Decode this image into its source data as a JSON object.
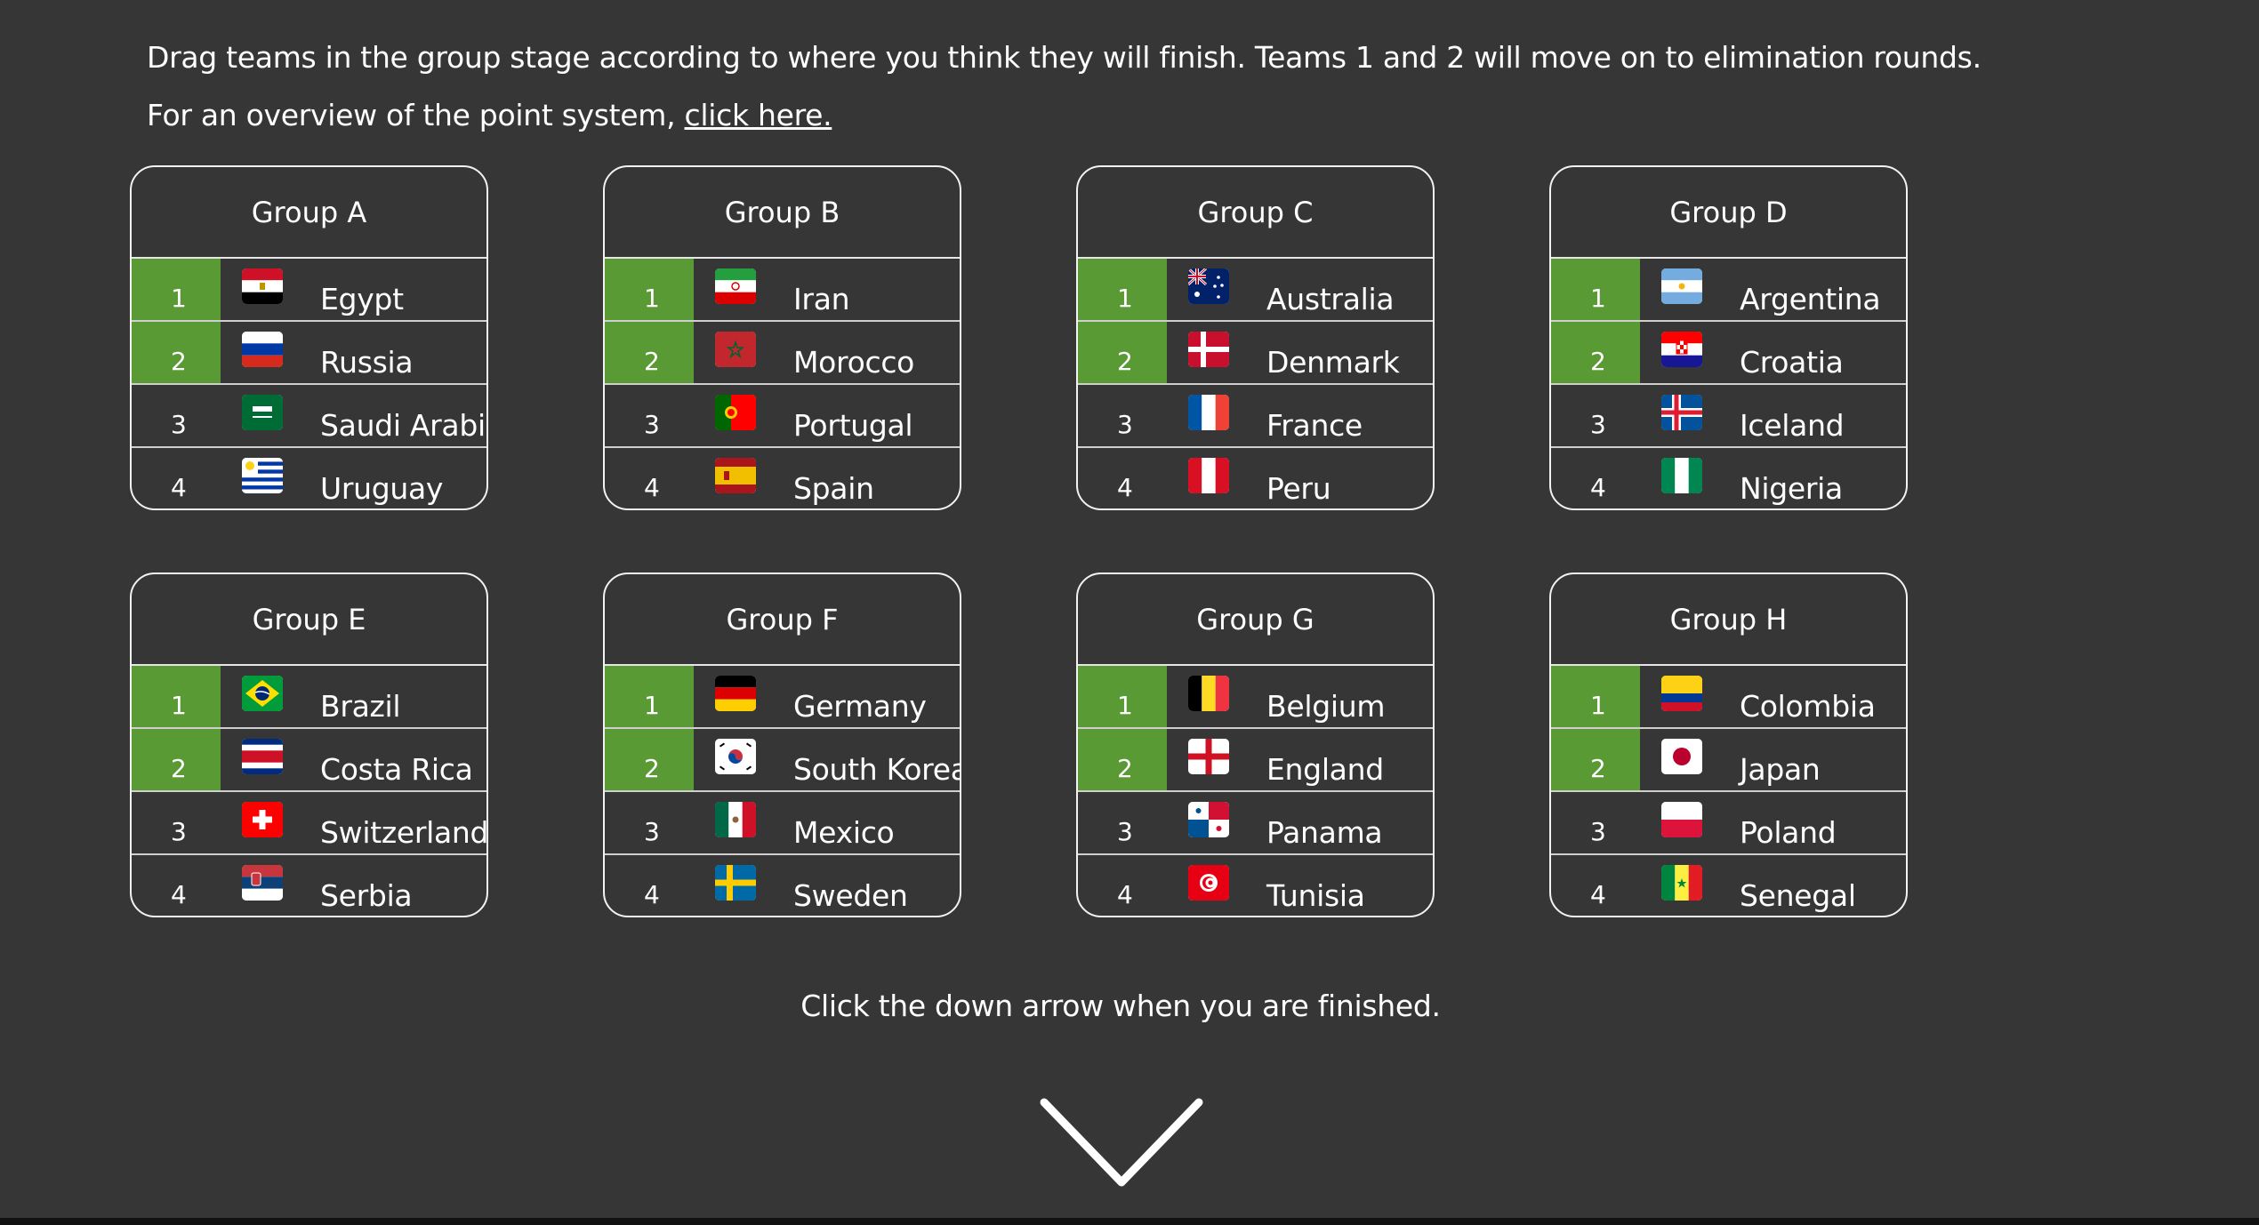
{
  "intro": {
    "line1": "Drag teams in the group stage according to where you think they will finish. Teams 1 and 2 will move on to elimination rounds.",
    "line2_prefix": "For an overview of the point system, ",
    "line2_link": "click here."
  },
  "colors": {
    "background": "#363636",
    "advance_green": "#5a9a35",
    "text": "#ffffff"
  },
  "groups": [
    {
      "title": "Group A",
      "teams": [
        {
          "rank": "1",
          "name": "Egypt",
          "flag": "egypt-flag-icon"
        },
        {
          "rank": "2",
          "name": "Russia",
          "flag": "russia-flag-icon"
        },
        {
          "rank": "3",
          "name": "Saudi Arabia",
          "flag": "saudi-arabia-flag-icon"
        },
        {
          "rank": "4",
          "name": "Uruguay",
          "flag": "uruguay-flag-icon"
        }
      ]
    },
    {
      "title": "Group B",
      "teams": [
        {
          "rank": "1",
          "name": "Iran",
          "flag": "iran-flag-icon"
        },
        {
          "rank": "2",
          "name": "Morocco",
          "flag": "morocco-flag-icon"
        },
        {
          "rank": "3",
          "name": "Portugal",
          "flag": "portugal-flag-icon"
        },
        {
          "rank": "4",
          "name": "Spain",
          "flag": "spain-flag-icon"
        }
      ]
    },
    {
      "title": "Group C",
      "teams": [
        {
          "rank": "1",
          "name": "Australia",
          "flag": "australia-flag-icon"
        },
        {
          "rank": "2",
          "name": "Denmark",
          "flag": "denmark-flag-icon"
        },
        {
          "rank": "3",
          "name": "France",
          "flag": "france-flag-icon"
        },
        {
          "rank": "4",
          "name": "Peru",
          "flag": "peru-flag-icon"
        }
      ]
    },
    {
      "title": "Group D",
      "teams": [
        {
          "rank": "1",
          "name": "Argentina",
          "flag": "argentina-flag-icon"
        },
        {
          "rank": "2",
          "name": "Croatia",
          "flag": "croatia-flag-icon"
        },
        {
          "rank": "3",
          "name": "Iceland",
          "flag": "iceland-flag-icon"
        },
        {
          "rank": "4",
          "name": "Nigeria",
          "flag": "nigeria-flag-icon"
        }
      ]
    },
    {
      "title": "Group E",
      "teams": [
        {
          "rank": "1",
          "name": "Brazil",
          "flag": "brazil-flag-icon"
        },
        {
          "rank": "2",
          "name": "Costa Rica",
          "flag": "costa-rica-flag-icon"
        },
        {
          "rank": "3",
          "name": "Switzerland",
          "flag": "switzerland-flag-icon"
        },
        {
          "rank": "4",
          "name": "Serbia",
          "flag": "serbia-flag-icon"
        }
      ]
    },
    {
      "title": "Group F",
      "teams": [
        {
          "rank": "1",
          "name": "Germany",
          "flag": "germany-flag-icon"
        },
        {
          "rank": "2",
          "name": "South Korea",
          "flag": "south-korea-flag-icon"
        },
        {
          "rank": "3",
          "name": "Mexico",
          "flag": "mexico-flag-icon"
        },
        {
          "rank": "4",
          "name": "Sweden",
          "flag": "sweden-flag-icon"
        }
      ]
    },
    {
      "title": "Group G",
      "teams": [
        {
          "rank": "1",
          "name": "Belgium",
          "flag": "belgium-flag-icon"
        },
        {
          "rank": "2",
          "name": "England",
          "flag": "england-flag-icon"
        },
        {
          "rank": "3",
          "name": "Panama",
          "flag": "panama-flag-icon"
        },
        {
          "rank": "4",
          "name": "Tunisia",
          "flag": "tunisia-flag-icon"
        }
      ]
    },
    {
      "title": "Group H",
      "teams": [
        {
          "rank": "1",
          "name": "Colombia",
          "flag": "colombia-flag-icon"
        },
        {
          "rank": "2",
          "name": "Japan",
          "flag": "japan-flag-icon"
        },
        {
          "rank": "3",
          "name": "Poland",
          "flag": "poland-flag-icon"
        },
        {
          "rank": "4",
          "name": "Senegal",
          "flag": "senegal-flag-icon"
        }
      ]
    }
  ],
  "finish_text": "Click the down arrow when you are finished.",
  "down_arrow_icon": "chevron-down-icon"
}
